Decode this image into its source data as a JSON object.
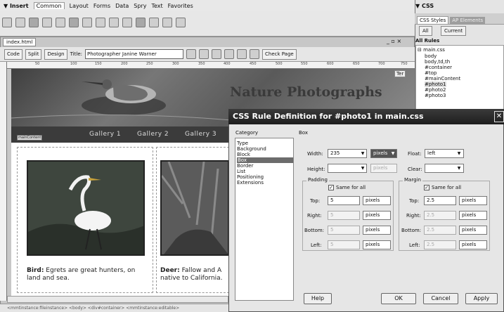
{
  "insert_bar": {
    "title": "▼ Insert",
    "tabs": [
      "Common",
      "Layout",
      "Forms",
      "Data",
      "Spry",
      "Text",
      "Favorites"
    ]
  },
  "document": {
    "tab": "index.html",
    "window_controls": "_ ▫ ×",
    "toolbar": {
      "code": "Code",
      "split": "Split",
      "design": "Design",
      "title_label": "Title:",
      "title_value": "Photographer Janine Warner",
      "check_page": "Check Page"
    },
    "ruler_ticks": [
      "50",
      "100",
      "150",
      "200",
      "250",
      "300",
      "350",
      "400",
      "450",
      "500",
      "550",
      "600",
      "650",
      "700",
      "750"
    ],
    "banner_title": "Nature Photographs",
    "ter_label": "Ter",
    "nav": [
      "Gallery 1",
      "Gallery 2",
      "Gallery 3"
    ],
    "main_content_tag": "mainContent",
    "captions": [
      {
        "bold": "Bird:",
        "text": " Egrets are great hunters, on",
        "line2": "land and sea."
      },
      {
        "bold": "Deer:",
        "text": " Fallow and A",
        "line2": "native to California."
      }
    ],
    "status": "<mmtinstance:fileinstance> <body> <div#container> <mmtinstance:editable>"
  },
  "css_panel": {
    "header": "▼ CSS",
    "tabs": [
      "CSS Styles",
      "AP Elements"
    ],
    "buttons": [
      "All",
      "Current"
    ],
    "all_rules_label": "All Rules",
    "rules": [
      "main.css",
      "body",
      "body,td,th",
      "#container",
      "#top",
      "#mainContent",
      "#photo1",
      "#photo2",
      "#photo3"
    ]
  },
  "dialog": {
    "title": "CSS Rule Definition for #photo1 in main.css",
    "category_label": "Category",
    "section_label": "Box",
    "categories": [
      "Type",
      "Background",
      "Block",
      "Box",
      "Border",
      "List",
      "Positioning",
      "Extensions"
    ],
    "selected_category": "Box",
    "width_label": "Width:",
    "width_value": "235",
    "width_unit": "pixels",
    "height_label": "Height:",
    "height_unit": "pixels",
    "float_label": "Float:",
    "float_value": "left",
    "clear_label": "Clear:",
    "padding": {
      "label": "Padding",
      "same_for_all": "Same for all",
      "top_label": "Top:",
      "top_value": "5",
      "top_unit": "pixels",
      "right_label": "Right:",
      "right_value": "5",
      "right_unit": "pixels",
      "bottom_label": "Bottom:",
      "bottom_value": "5",
      "bottom_unit": "pixels",
      "left_label": "Left:",
      "left_value": "5",
      "left_unit": "pixels"
    },
    "margin": {
      "label": "Margin",
      "same_for_all": "Same for all",
      "top_label": "Top:",
      "top_value": "2.5",
      "top_unit": "pixels",
      "right_label": "Right:",
      "right_value": "2.5",
      "right_unit": "pixels",
      "bottom_label": "Bottom:",
      "bottom_value": "2.5",
      "bottom_unit": "pixels",
      "left_label": "Left:",
      "left_value": "2.5",
      "left_unit": "pixels"
    },
    "help": "Help",
    "ok": "OK",
    "cancel": "Cancel",
    "apply": "Apply"
  }
}
